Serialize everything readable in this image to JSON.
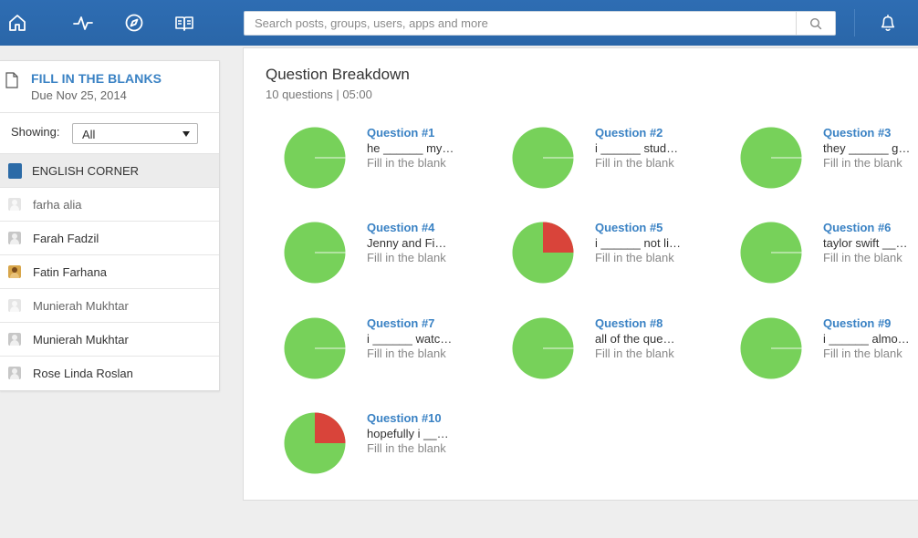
{
  "colors": {
    "topbar": "#2b6cb0",
    "accent": "#3a82c4",
    "correct": "#77d15a",
    "incorrect": "#d9443a"
  },
  "topbar": {
    "icons": [
      "home-icon",
      "activity-icon",
      "compass-icon",
      "book-icon"
    ],
    "search_placeholder": "Search posts, groups, users, apps and more"
  },
  "sidebar": {
    "assignment_title": "FILL IN THE BLANKS",
    "assignment_due": "Due Nov 25, 2014",
    "showing_label": "Showing:",
    "showing_value": "All",
    "group_name": "ENGLISH CORNER",
    "students": [
      {
        "name": "farha alia"
      },
      {
        "name": "Farah Fadzil"
      },
      {
        "name": "Fatin Farhana"
      },
      {
        "name": "Munierah Mukhtar"
      },
      {
        "name": "Munierah Mukhtar"
      },
      {
        "name": "Rose Linda Roslan"
      }
    ]
  },
  "main": {
    "title": "Question Breakdown",
    "subtitle": "10 questions | 05:00",
    "questions": [
      {
        "title": "Question #1",
        "text": "he ______ my…",
        "type": "Fill in the blank",
        "incorrect_fraction": 0
      },
      {
        "title": "Question #2",
        "text": "i ______ stud…",
        "type": "Fill in the blank",
        "incorrect_fraction": 0
      },
      {
        "title": "Question #3",
        "text": "they ______ g…",
        "type": "Fill in the blank",
        "incorrect_fraction": 0
      },
      {
        "title": "Question #4",
        "text": "Jenny and Fi…",
        "type": "Fill in the blank",
        "incorrect_fraction": 0
      },
      {
        "title": "Question #5",
        "text": "i ______ not li…",
        "type": "Fill in the blank",
        "incorrect_fraction": 0.25
      },
      {
        "title": "Question #6",
        "text": "taylor swift __…",
        "type": "Fill in the blank",
        "incorrect_fraction": 0
      },
      {
        "title": "Question #7",
        "text": "i ______ watc…",
        "type": "Fill in the blank",
        "incorrect_fraction": 0
      },
      {
        "title": "Question #8",
        "text": "all of the que…",
        "type": "Fill in the blank",
        "incorrect_fraction": 0
      },
      {
        "title": "Question #9",
        "text": "i ______ almo…",
        "type": "Fill in the blank",
        "incorrect_fraction": 0
      },
      {
        "title": "Question #10",
        "text": "hopefully i __…",
        "type": "Fill in the blank",
        "incorrect_fraction": 0.25
      }
    ]
  }
}
